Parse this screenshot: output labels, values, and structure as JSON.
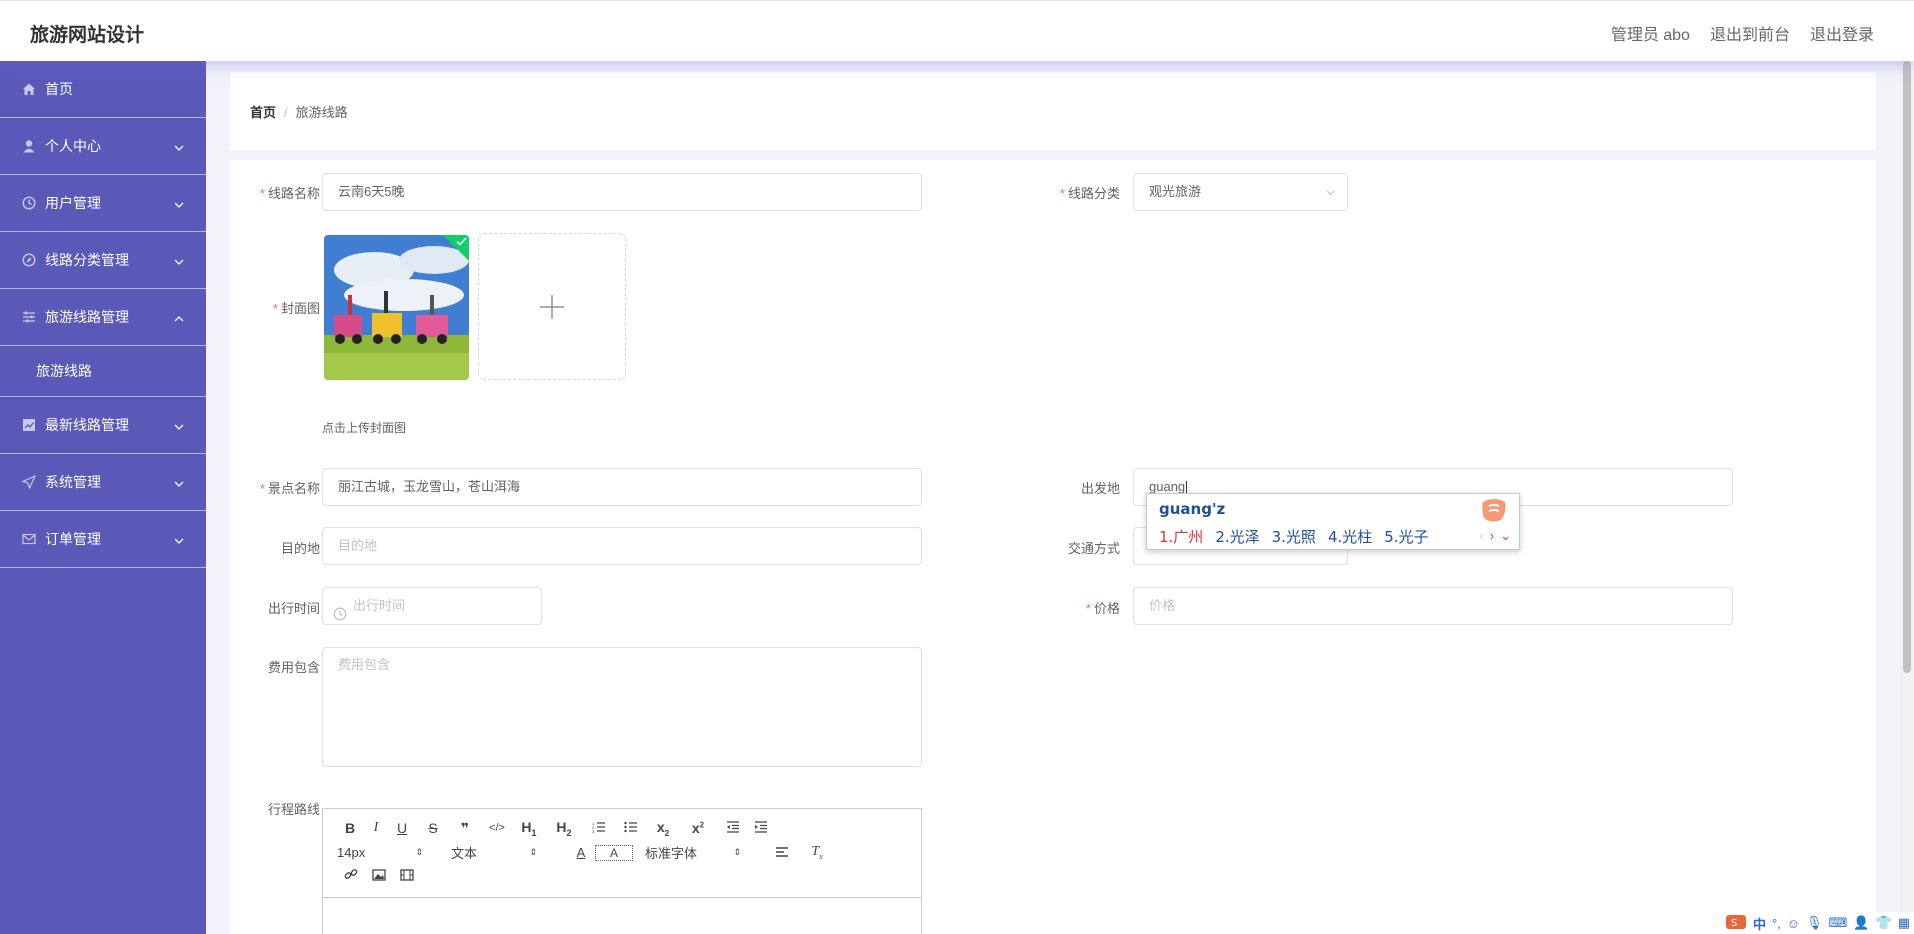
{
  "header": {
    "title": "旅游网站设计",
    "nav": {
      "admin": "管理员 abo",
      "front": "退出到前台",
      "logout": "退出登录"
    }
  },
  "sidebar": {
    "items": [
      {
        "label": "首页",
        "icon": "home-icon"
      },
      {
        "label": "个人中心",
        "icon": "user-icon"
      },
      {
        "label": "用户管理",
        "icon": "clock-icon"
      },
      {
        "label": "线路分类管理",
        "icon": "compass-icon"
      },
      {
        "label": "旅游线路管理",
        "icon": "sliders-icon"
      },
      {
        "label": "最新线路管理",
        "icon": "chart-icon"
      },
      {
        "label": "系统管理",
        "icon": "send-icon"
      },
      {
        "label": "订单管理",
        "icon": "mail-icon"
      }
    ],
    "sub": {
      "label": "旅游线路"
    }
  },
  "breadcrumb": {
    "home": "首页",
    "sep": "/",
    "current": "旅游线路"
  },
  "form": {
    "route_name": {
      "label": "线路名称",
      "value": "云南6天5晚"
    },
    "category": {
      "label": "线路分类",
      "value": "观光旅游"
    },
    "cover": {
      "label": "封面图",
      "tip": "点击上传封面图"
    },
    "spots": {
      "label": "景点名称",
      "value": "丽江古城，玉龙雪山，苍山洱海"
    },
    "departure": {
      "label": "出发地",
      "value": "guang"
    },
    "destination": {
      "label": "目的地",
      "placeholder": "目的地"
    },
    "transport": {
      "label": "交通方式"
    },
    "travel_time": {
      "label": "出行时间",
      "placeholder": "出行时间"
    },
    "price": {
      "label": "价格",
      "placeholder": "价格"
    },
    "includes": {
      "label": "费用包含",
      "placeholder": "费用包含"
    },
    "itinerary": {
      "label": "行程路线"
    }
  },
  "ime": {
    "composition": "guang'z",
    "candidates": [
      "1.广州",
      "2.光泽",
      "3.光照",
      "4.光柱",
      "5.光子"
    ]
  },
  "editor": {
    "font_size": "14px",
    "block_type": "文本",
    "font_family": "标准字体"
  },
  "tray": {
    "lang": "中"
  },
  "colors": {
    "sidebar": "#5b59b8",
    "required": "#f56c6c",
    "success": "#13ce66"
  }
}
